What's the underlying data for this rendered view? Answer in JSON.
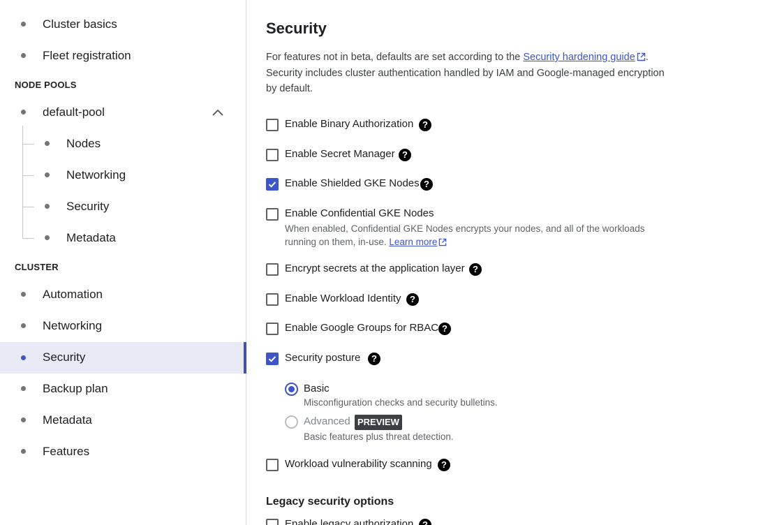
{
  "sidebar": {
    "top_items": [
      {
        "label": "Cluster basics"
      },
      {
        "label": "Fleet registration"
      }
    ],
    "node_pools_heading": "NODE POOLS",
    "pool": {
      "label": "default-pool",
      "expanded": true,
      "children": [
        {
          "label": "Nodes"
        },
        {
          "label": "Networking"
        },
        {
          "label": "Security"
        },
        {
          "label": "Metadata"
        }
      ]
    },
    "cluster_heading": "CLUSTER",
    "cluster_items": [
      {
        "label": "Automation"
      },
      {
        "label": "Networking"
      },
      {
        "label": "Security",
        "active": true
      },
      {
        "label": "Backup plan"
      },
      {
        "label": "Metadata"
      },
      {
        "label": "Features"
      }
    ],
    "colors": {
      "active_bg": "#e8eaf6",
      "accent": "#3f51b5"
    }
  },
  "main": {
    "title": "Security",
    "intro": {
      "before_link": "For features not in beta, defaults are set according to the ",
      "link": "Security hardening guide",
      "after_link": ".",
      "line2": "Security includes cluster authentication handled by IAM and Google-managed encryption by default."
    },
    "options": [
      {
        "label": "Enable Binary Authorization",
        "checked": false,
        "help": true
      },
      {
        "label": "Enable Secret Manager",
        "checked": false,
        "help": true
      },
      {
        "label": "Enable Shielded GKE Nodes",
        "checked": true,
        "help": true
      },
      {
        "label": "Enable Confidential GKE Nodes",
        "checked": false,
        "help": false,
        "description": "When enabled, Confidential GKE Nodes encrypts your nodes, and all of the workloads running on them, in-use.",
        "description_link": "Learn more"
      },
      {
        "label": "Encrypt secrets at the application layer",
        "checked": false,
        "help": true
      },
      {
        "label": "Enable Workload Identity",
        "checked": false,
        "help": true
      },
      {
        "label": "Enable Google Groups for RBAC",
        "checked": false,
        "help": true
      },
      {
        "label": "Security posture",
        "checked": true,
        "help": true
      },
      {
        "label": "Workload vulnerability scanning",
        "checked": false,
        "help": true
      }
    ],
    "posture": {
      "basic": {
        "label": "Basic",
        "description": "Misconfiguration checks and security bulletins.",
        "selected": true
      },
      "advanced": {
        "label": "Advanced",
        "badge": "PREVIEW",
        "description": "Basic features plus threat detection.",
        "selected": false,
        "disabled": true
      }
    },
    "legacy_heading": "Legacy security options",
    "legacy_first_option": "Enable legacy authorization",
    "accent": "#3c55c8"
  }
}
